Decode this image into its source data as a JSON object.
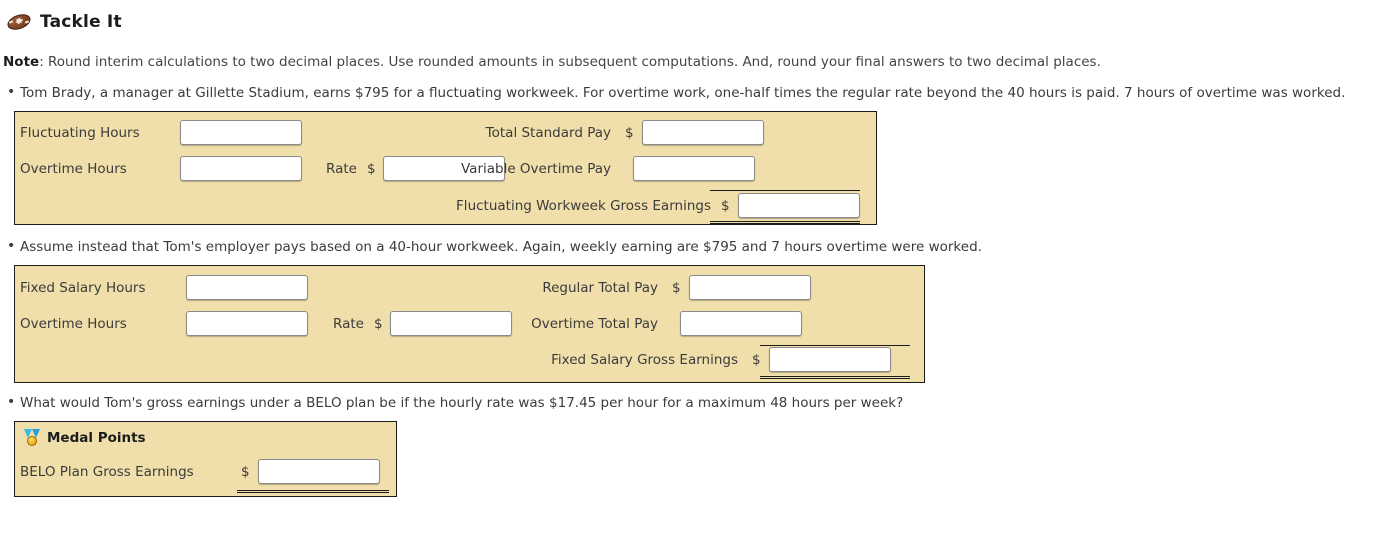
{
  "header": {
    "icon": "football-icon",
    "title": "Tackle It"
  },
  "note": {
    "label": "Note",
    "text": ": Round interim calculations to two decimal places. Use rounded amounts in subsequent computations. And, round your final answers to two decimal places."
  },
  "questions": [
    {
      "bullet": "Tom Brady, a manager at Gillette Stadium, earns $795 for a fluctuating workweek. For overtime work, one-half times the regular rate beyond the 40 hours is paid. 7 hours of overtime was worked."
    },
    {
      "bullet": "Assume instead that Tom's employer pays based on a 40-hour workweek. Again, weekly earning are $795 and 7 hours overtime were worked."
    },
    {
      "bullet": "What would Tom's gross earnings under a BELO plan be if the hourly rate was $17.45 per hour for a maximum 48 hours per week?"
    }
  ],
  "panel1": {
    "fluctuating_hours_label": "Fluctuating Hours",
    "fluctuating_hours_value": "",
    "overtime_hours_label": "Overtime Hours",
    "overtime_hours_value": "",
    "rate_label": "Rate",
    "rate_dollar": "$",
    "rate_value": "",
    "total_standard_pay_label": "Total Standard Pay",
    "total_standard_pay_dollar": "$",
    "total_standard_pay_value": "",
    "variable_overtime_pay_label": "Variable Overtime Pay",
    "variable_overtime_pay_value": "",
    "gross_earnings_label": "Fluctuating Workweek Gross Earnings",
    "gross_earnings_dollar": "$",
    "gross_earnings_value": ""
  },
  "panel2": {
    "fixed_salary_hours_label": "Fixed Salary Hours",
    "fixed_salary_hours_value": "",
    "overtime_hours_label": "Overtime Hours",
    "overtime_hours_value": "",
    "rate_label": "Rate",
    "rate_dollar": "$",
    "rate_value": "",
    "regular_total_pay_label": "Regular Total Pay",
    "regular_total_pay_dollar": "$",
    "regular_total_pay_value": "",
    "overtime_total_pay_label": "Overtime Total Pay",
    "overtime_total_pay_value": "",
    "gross_earnings_label": "Fixed Salary Gross Earnings",
    "gross_earnings_dollar": "$",
    "gross_earnings_value": ""
  },
  "panel3": {
    "icon": "medal-icon",
    "title": "Medal Points",
    "belo_label": "BELO Plan Gross Earnings",
    "belo_dollar": "$",
    "belo_value": ""
  },
  "colors": {
    "panel_background": "#f0dfaa",
    "panel_border": "#1c1c1c",
    "text": "#3b3b3b",
    "page_background": "#ffffff"
  }
}
